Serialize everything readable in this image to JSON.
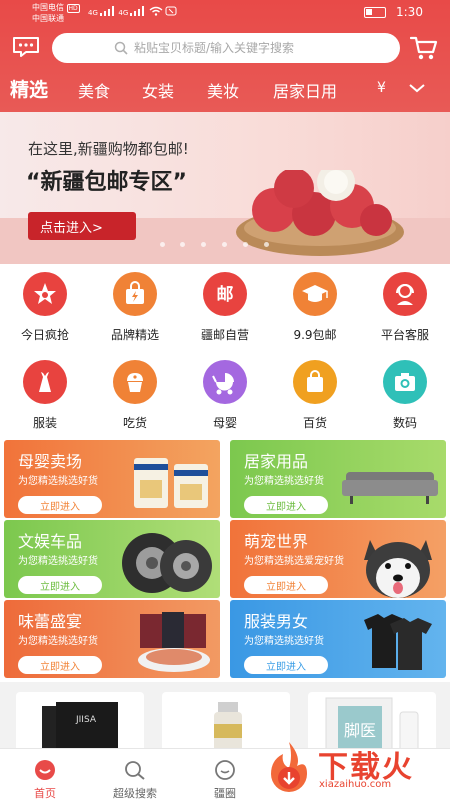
{
  "status_bar": {
    "carrier1": "中国电信",
    "carrier1_badge": "HD",
    "carrier2": "中国联通",
    "net1": "4G",
    "net2": "4G",
    "time": "1:30"
  },
  "header": {
    "search_placeholder": "粘贴宝贝标题/输入关键字搜索",
    "message_icon": "message-icon",
    "cart_icon": "cart-icon"
  },
  "tabs": [
    {
      "label": "精选",
      "active": true
    },
    {
      "label": "美食"
    },
    {
      "label": "女装"
    },
    {
      "label": "美妆"
    },
    {
      "label": "居家日用"
    },
    {
      "label": "¥"
    }
  ],
  "banner": {
    "line1": "在这里,新疆购物都包邮!",
    "line2": "“新疆包邮专区”",
    "button": "点击进入>"
  },
  "categories": [
    {
      "label": "今日疯抢",
      "icon": "star-icon",
      "color": "#e8433f"
    },
    {
      "label": "品牌精选",
      "icon": "bag-lightning-icon",
      "color": "#f08236"
    },
    {
      "label": "疆邮自营",
      "icon": "post-icon",
      "color": "#e8433f"
    },
    {
      "label": "9.9包邮",
      "icon": "grad-cap-icon",
      "color": "#f08236"
    },
    {
      "label": "平台客服",
      "icon": "headset-icon",
      "color": "#e8433f"
    },
    {
      "label": "服装",
      "icon": "dress-icon",
      "color": "#e8433f"
    },
    {
      "label": "吃货",
      "icon": "cupcake-icon",
      "color": "#f08236"
    },
    {
      "label": "母婴",
      "icon": "stroller-icon",
      "color": "#a468e0"
    },
    {
      "label": "百货",
      "icon": "shopping-bag-icon",
      "color": "#f0a020"
    },
    {
      "label": "数码",
      "icon": "camera-icon",
      "color": "#2fc0b8"
    }
  ],
  "promos": [
    {
      "title": "母婴卖场",
      "sub": "为您精选挑选好货",
      "button": "立即进入",
      "bg": "#f2853a",
      "btn_color": "#f2853a"
    },
    {
      "title": "居家用品",
      "sub": "为您精选挑选好货",
      "button": "立即进入",
      "bg": "#7fcc4c",
      "btn_color": "#7fcc4c"
    },
    {
      "title": "文娱车品",
      "sub": "为您精选挑选好货",
      "button": "立即进入",
      "bg": "#8ccf52",
      "btn_color": "#7fcc4c"
    },
    {
      "title": "萌宠世界",
      "sub": "为您精选挑选爱宠好货",
      "button": "立即进入",
      "bg": "#f2853a",
      "btn_color": "#f2853a"
    },
    {
      "title": "味蕾盛宴",
      "sub": "为您精选挑选好货",
      "button": "立即进入",
      "bg": "#f0763a",
      "btn_color": "#f2853a"
    },
    {
      "title": "服装男女",
      "sub": "为您精选挑选好货",
      "button": "立即进入",
      "bg": "#3b9ee6",
      "btn_color": "#3b9ee6"
    }
  ],
  "products": [
    {
      "label": "JIISA"
    },
    {
      "label": ""
    },
    {
      "label": "脚医"
    }
  ],
  "nav": [
    {
      "label": "首页",
      "active": true
    },
    {
      "label": "超级搜索"
    },
    {
      "label": "疆圈"
    }
  ],
  "watermark": {
    "title": "下载火",
    "sub": "xiazaihuo.com"
  }
}
